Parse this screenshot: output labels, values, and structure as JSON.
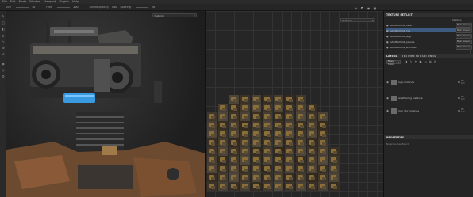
{
  "menu": [
    "File",
    "Edit",
    "Mode",
    "Window",
    "Viewport",
    "Plugins",
    "Help"
  ],
  "toolbar": {
    "size_label": "Size",
    "size_value": "10",
    "flow_label": "Flow",
    "flow_value": "100",
    "stroke_opacity_label": "Stroke opacity",
    "stroke_opacity_value": "100",
    "spacing_label": "Spacing",
    "spacing_value": "20"
  },
  "viewport": {
    "left_material_label": "Material",
    "right_material_label": "Material"
  },
  "texture_set_list": {
    "title": "TEXTURE SET LIST",
    "settings_label": "Settings",
    "items": [
      {
        "name": "retroBRAVO4_head",
        "shader": "Main shader"
      },
      {
        "name": "retroBRAVO4_hip",
        "shader": "Main shader"
      },
      {
        "name": "retroBRAVO4_legs",
        "shader": "Main shader"
      },
      {
        "name": "retroBRAVO4_pelvise",
        "shader": "Main shader"
      },
      {
        "name": "retroBRAVO4_shoulder",
        "shader": "Main shader"
      }
    ]
  },
  "layers": {
    "tab_layers": "LAYERS",
    "tab_texture_set_settings": "TEXTURE SET SETTINGS",
    "channel_select": "Base Color",
    "items": [
      {
        "name": "logo instance",
        "blend": "Pth",
        "opacity": "100"
      },
      {
        "name": "weathering instance",
        "blend": "Pth",
        "opacity": "100"
      },
      {
        "name": "lock dec instance",
        "blend": "Pth",
        "opacity": "100"
      }
    ]
  },
  "properties": {
    "title": "PROPERTIES",
    "empty_text": "No properties found"
  },
  "colors": {
    "selection_highlight": "#3d5a80",
    "panel_bg": "#252525",
    "header_bg": "#303030"
  }
}
